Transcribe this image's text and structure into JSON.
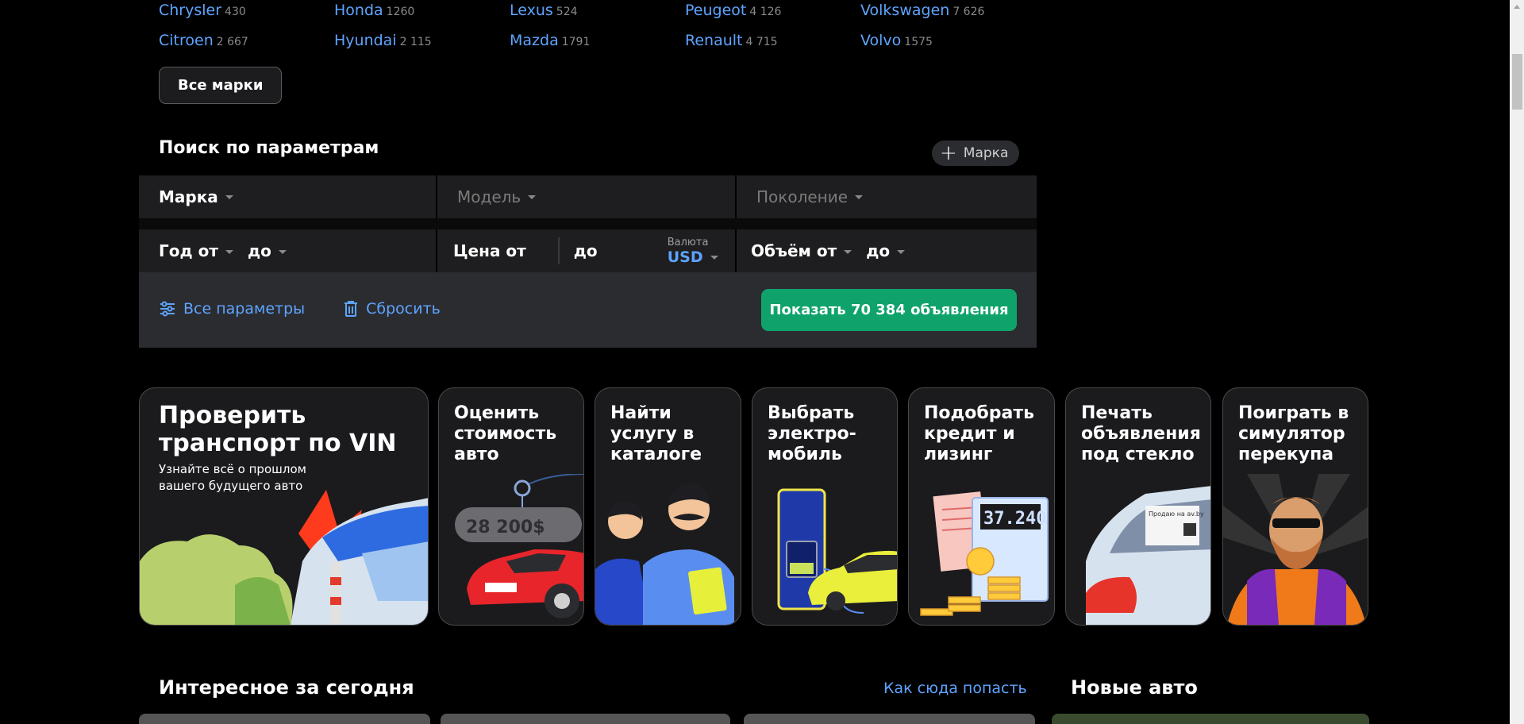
{
  "brands": {
    "rows": [
      [
        {
          "name": "Chrysler",
          "count": "430"
        },
        {
          "name": "Honda",
          "count": "1260"
        },
        {
          "name": "Lexus",
          "count": "524"
        },
        {
          "name": "Peugeot",
          "count": "4 126"
        },
        {
          "name": "Volkswagen",
          "count": "7 626"
        }
      ],
      [
        {
          "name": "Citroen",
          "count": "2 667"
        },
        {
          "name": "Hyundai",
          "count": "2 115"
        },
        {
          "name": "Mazda",
          "count": "1791"
        },
        {
          "name": "Renault",
          "count": "4 715"
        },
        {
          "name": "Volvo",
          "count": "1575"
        }
      ]
    ],
    "all_button": "Все марки"
  },
  "search": {
    "title": "Поиск по параметрам",
    "add_brand": "Марка",
    "brand": "Марка",
    "model": "Модель",
    "generation": "Поколение",
    "year_from": "Год от",
    "year_to": "до",
    "price_from": "Цена от",
    "price_to": "до",
    "currency_label": "Валюта",
    "currency": "USD",
    "volume_from": "Объём от",
    "volume_to": "до",
    "all_params": "Все параметры",
    "reset": "Сбросить",
    "show_button": "Показать 70 384 объявления"
  },
  "tiles": [
    {
      "title": "Проверить транспорт по VIN",
      "subtitle": "Узнайте всё о прошлом вашего будущего авто"
    },
    {
      "title": "Оценить стоимость авто",
      "badge": "28 200$"
    },
    {
      "title": "Найти услугу в каталоге"
    },
    {
      "title": "Выбрать электро- мобиль"
    },
    {
      "title": "Подобрать кредит и лизинг",
      "figure": "37.240"
    },
    {
      "title": "Печать объявления под стекло",
      "sign": "Продаю на av.by"
    },
    {
      "title": "Поиграть в симулятор перекупа"
    }
  ],
  "bottom": {
    "interesting": "Интересное за сегодня",
    "how": "Как сюда попасть",
    "new_cars": "Новые авто"
  },
  "colors": {
    "accent": "#5ea4ff",
    "cta": "#0fa36b",
    "panel": "#2b2c30"
  }
}
